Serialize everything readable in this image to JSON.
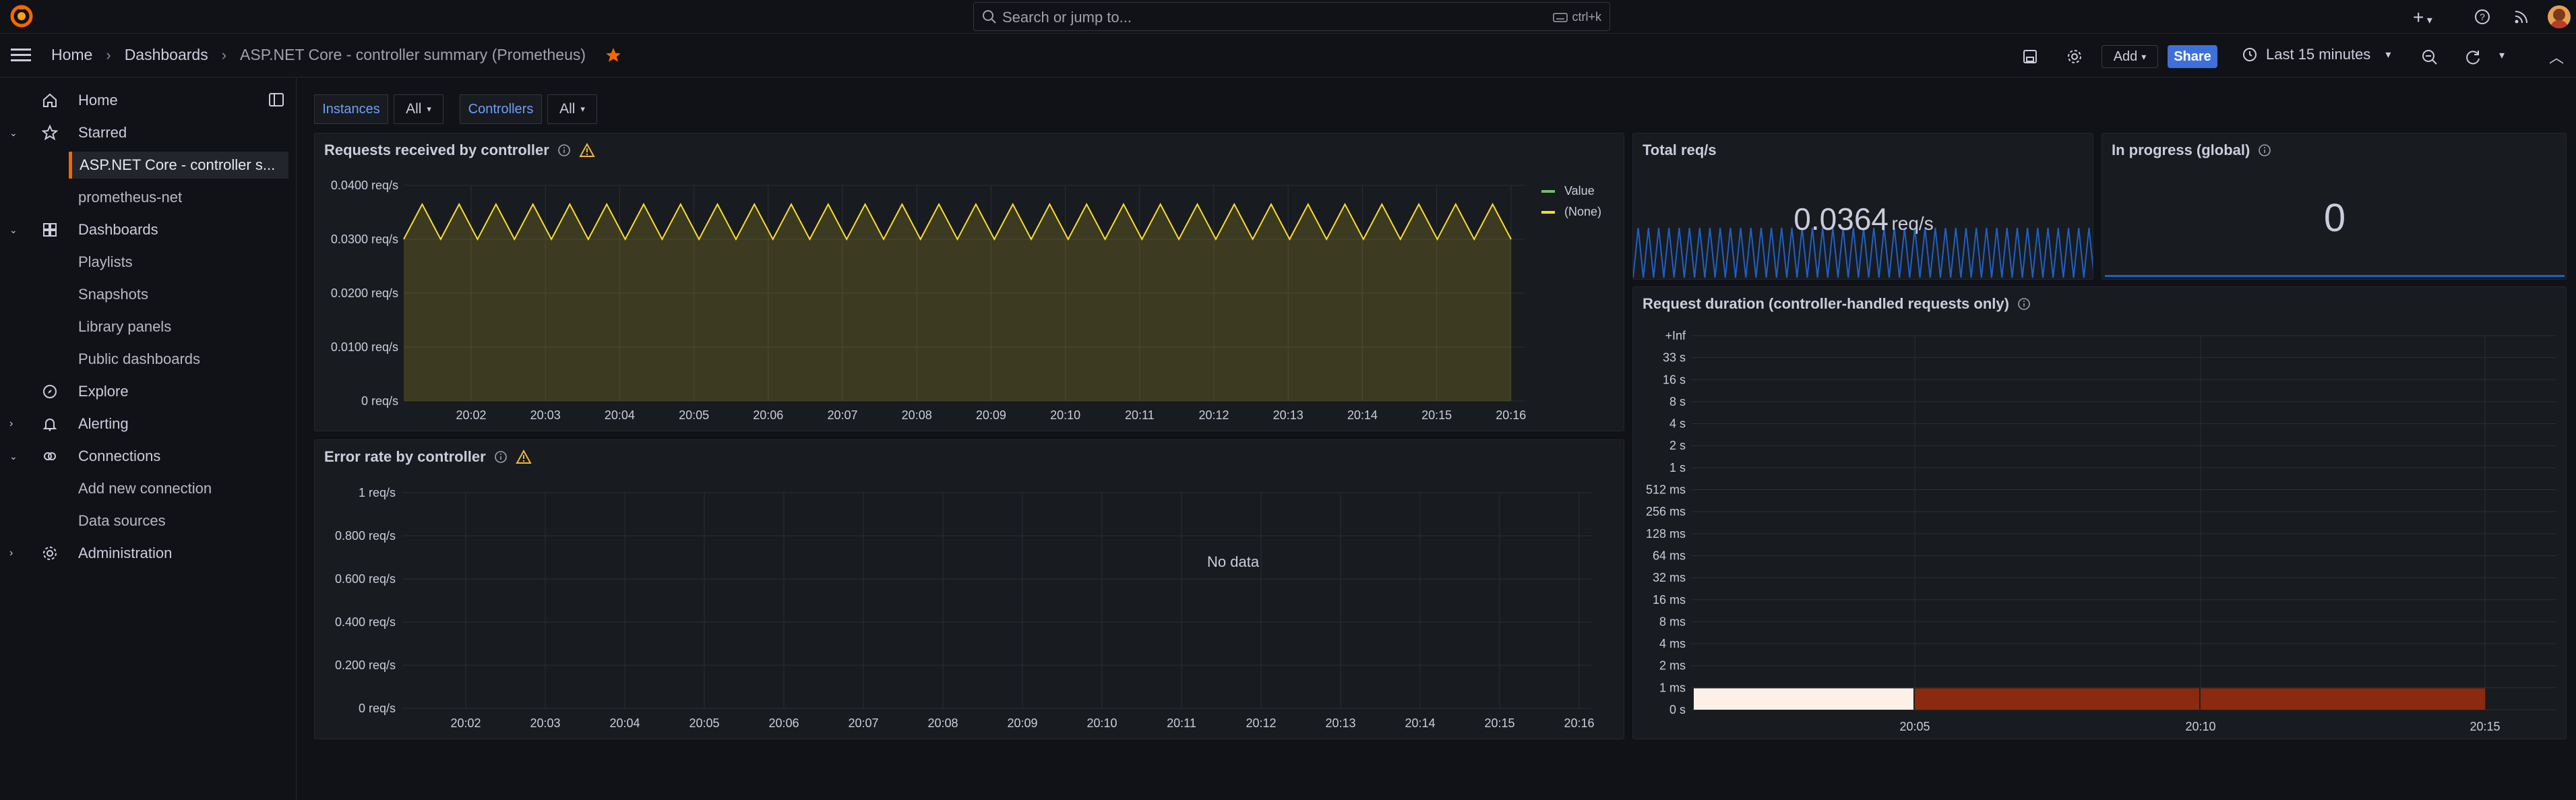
{
  "search": {
    "placeholder": "Search or jump to...",
    "shortcut": "ctrl+k"
  },
  "breadcrumb": {
    "home": "Home",
    "dashboards": "Dashboards",
    "current": "ASP.NET Core - controller summary (Prometheus)"
  },
  "toolbar": {
    "add_label": "Add",
    "share_label": "Share",
    "time_range": "Last 15 minutes"
  },
  "sidebar": {
    "home": "Home",
    "starred": "Starred",
    "starred_items": [
      "ASP.NET Core - controller s...",
      "prometheus-net"
    ],
    "dashboards": "Dashboards",
    "dashboards_items": [
      "Playlists",
      "Snapshots",
      "Library panels",
      "Public dashboards"
    ],
    "explore": "Explore",
    "alerting": "Alerting",
    "connections": "Connections",
    "connections_items": [
      "Add new connection",
      "Data sources"
    ],
    "administration": "Administration"
  },
  "variables": {
    "instances": {
      "label": "Instances",
      "value": "All"
    },
    "controllers": {
      "label": "Controllers",
      "value": "All"
    }
  },
  "colors": {
    "accent": "#f46800",
    "series_value": "#73bf69",
    "series_none": "#fade2a",
    "blue": "#1f60c4",
    "primary": "#3d71d9"
  },
  "panels": {
    "requests": {
      "title": "Requests received by controller",
      "y_ticks": [
        "0 req/s",
        "0.0100 req/s",
        "0.0200 req/s",
        "0.0300 req/s",
        "0.0400 req/s"
      ],
      "x_ticks": [
        "20:02",
        "20:03",
        "20:04",
        "20:05",
        "20:06",
        "20:07",
        "20:08",
        "20:09",
        "20:10",
        "20:11",
        "20:12",
        "20:13",
        "20:14",
        "20:15",
        "20:16"
      ],
      "legend": [
        "Value",
        "(None)"
      ]
    },
    "total": {
      "title": "Total req/s",
      "value": "0.0364",
      "unit": "req/s"
    },
    "inprogress": {
      "title": "In progress (global)",
      "value": "0"
    },
    "errors": {
      "title": "Error rate by controller",
      "no_data": "No data",
      "y_ticks": [
        "0 req/s",
        "0.200 req/s",
        "0.400 req/s",
        "0.600 req/s",
        "0.800 req/s",
        "1 req/s"
      ],
      "x_ticks": [
        "20:02",
        "20:03",
        "20:04",
        "20:05",
        "20:06",
        "20:07",
        "20:08",
        "20:09",
        "20:10",
        "20:11",
        "20:12",
        "20:13",
        "20:14",
        "20:15",
        "20:16"
      ]
    },
    "duration": {
      "title": "Request duration (controller-handled requests only)",
      "y_ticks": [
        "0 s",
        "1 ms",
        "2 ms",
        "4 ms",
        "8 ms",
        "16 ms",
        "32 ms",
        "64 ms",
        "128 ms",
        "256 ms",
        "512 ms",
        "1 s",
        "2 s",
        "4 s",
        "8 s",
        "16 s",
        "33 s",
        "+Inf"
      ],
      "x_ticks": [
        "20:05",
        "20:10",
        "20:15"
      ]
    }
  },
  "chart_data": [
    {
      "type": "area",
      "title": "Requests received by controller",
      "xlabel": "",
      "ylabel": "",
      "ylim": [
        0,
        0.04
      ],
      "x_ticks": [
        "20:02",
        "20:03",
        "20:04",
        "20:05",
        "20:06",
        "20:07",
        "20:08",
        "20:09",
        "20:10",
        "20:11",
        "20:12",
        "20:13",
        "20:14",
        "20:15",
        "20:16"
      ],
      "series": [
        {
          "name": "Value",
          "values": []
        },
        {
          "name": "(None)",
          "pattern": "oscillating between ~0.0300 and ~0.0365 req/s, period ~30s",
          "min": 0.03,
          "max": 0.0365
        }
      ],
      "legend": "right"
    },
    {
      "type": "line",
      "title": "Error rate by controller",
      "ylim": [
        0,
        1
      ],
      "series": []
    },
    {
      "type": "heatmap",
      "title": "Request duration (controller-handled requests only)",
      "y_buckets": [
        "0 s",
        "1 ms",
        "2 ms",
        "4 ms",
        "8 ms",
        "16 ms",
        "32 ms",
        "64 ms",
        "128 ms",
        "256 ms",
        "512 ms",
        "1 s",
        "2 s",
        "4 s",
        "8 s",
        "16 s",
        "33 s",
        "+Inf"
      ],
      "x_ticks": [
        "20:05",
        "20:10",
        "20:15"
      ],
      "cells": [
        {
          "bucket": "0 s",
          "from": "20:01",
          "to": "20:05",
          "intensity": "high"
        },
        {
          "bucket": "0 s",
          "from": "20:05",
          "to": "20:15",
          "intensity": "medium"
        }
      ]
    }
  ]
}
